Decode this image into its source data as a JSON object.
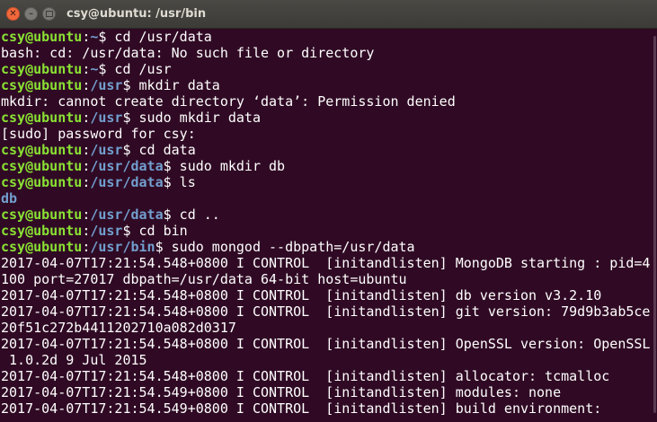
{
  "window": {
    "title": "csy@ubuntu: /usr/bin"
  },
  "colors": {
    "background": "#300a24",
    "user_host": "#8ae234",
    "path": "#729fcf",
    "text": "#ffffff"
  },
  "lines": [
    {
      "kind": "prompt",
      "user": "csy@ubuntu",
      "path": "~",
      "cmd": " cd /usr/data"
    },
    {
      "kind": "out",
      "text": "bash: cd: /usr/data: No such file or directory"
    },
    {
      "kind": "prompt",
      "user": "csy@ubuntu",
      "path": "~",
      "cmd": " cd /usr"
    },
    {
      "kind": "prompt",
      "user": "csy@ubuntu",
      "path": "/usr",
      "cmd": " mkdir data"
    },
    {
      "kind": "out",
      "text": "mkdir: cannot create directory ‘data’: Permission denied"
    },
    {
      "kind": "prompt",
      "user": "csy@ubuntu",
      "path": "/usr",
      "cmd": " sudo mkdir data"
    },
    {
      "kind": "out",
      "text": "[sudo] password for csy:"
    },
    {
      "kind": "prompt",
      "user": "csy@ubuntu",
      "path": "/usr",
      "cmd": " cd data"
    },
    {
      "kind": "prompt",
      "user": "csy@ubuntu",
      "path": "/usr/data",
      "cmd": " sudo mkdir db"
    },
    {
      "kind": "prompt",
      "user": "csy@ubuntu",
      "path": "/usr/data",
      "cmd": " ls"
    },
    {
      "kind": "dir",
      "text": "db"
    },
    {
      "kind": "prompt",
      "user": "csy@ubuntu",
      "path": "/usr/data",
      "cmd": " cd .."
    },
    {
      "kind": "prompt",
      "user": "csy@ubuntu",
      "path": "/usr",
      "cmd": " cd bin"
    },
    {
      "kind": "prompt",
      "user": "csy@ubuntu",
      "path": "/usr/bin",
      "cmd": " sudo mongod --dbpath=/usr/data"
    },
    {
      "kind": "out",
      "text": "2017-04-07T17:21:54.548+0800 I CONTROL  [initandlisten] MongoDB starting : pid=4"
    },
    {
      "kind": "out",
      "text": "100 port=27017 dbpath=/usr/data 64-bit host=ubuntu"
    },
    {
      "kind": "out",
      "text": "2017-04-07T17:21:54.548+0800 I CONTROL  [initandlisten] db version v3.2.10"
    },
    {
      "kind": "out",
      "text": "2017-04-07T17:21:54.548+0800 I CONTROL  [initandlisten] git version: 79d9b3ab5ce"
    },
    {
      "kind": "out",
      "text": "20f51c272b4411202710a082d0317"
    },
    {
      "kind": "out",
      "text": "2017-04-07T17:21:54.548+0800 I CONTROL  [initandlisten] OpenSSL version: OpenSSL"
    },
    {
      "kind": "out",
      "text": " 1.0.2d 9 Jul 2015"
    },
    {
      "kind": "out",
      "text": "2017-04-07T17:21:54.548+0800 I CONTROL  [initandlisten] allocator: tcmalloc"
    },
    {
      "kind": "out",
      "text": "2017-04-07T17:21:54.549+0800 I CONTROL  [initandlisten] modules: none"
    },
    {
      "kind": "out",
      "text": "2017-04-07T17:21:54.549+0800 I CONTROL  [initandlisten] build environment:"
    }
  ]
}
